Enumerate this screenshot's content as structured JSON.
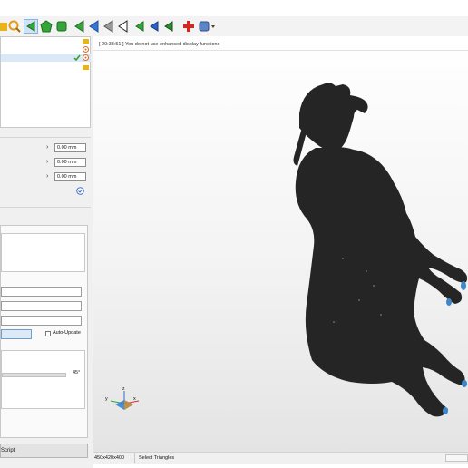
{
  "log": {
    "message": "[ 20:33:51 ] You do not use enhanced display functions"
  },
  "transform": {
    "fields": [
      {
        "value": "0.00 mm"
      },
      {
        "value": "0.00 mm"
      },
      {
        "value": "0.00 mm"
      }
    ]
  },
  "options": {
    "auto_update_label": "Auto-Update",
    "auto_update_checked": false
  },
  "slider": {
    "value_label": "45°"
  },
  "script_button": {
    "label": "Script"
  },
  "axes": {
    "x_label": "x",
    "y_label": "y",
    "z_label": "z"
  },
  "status": {
    "dimensions": "450x420x400",
    "mode": "Select Triangles"
  },
  "colors": {
    "toolbar_bg": "#f3f3f3",
    "panel_bg": "#f0f0f0",
    "model_fill": "#252525",
    "selection_blue": "#cfe3f7"
  }
}
